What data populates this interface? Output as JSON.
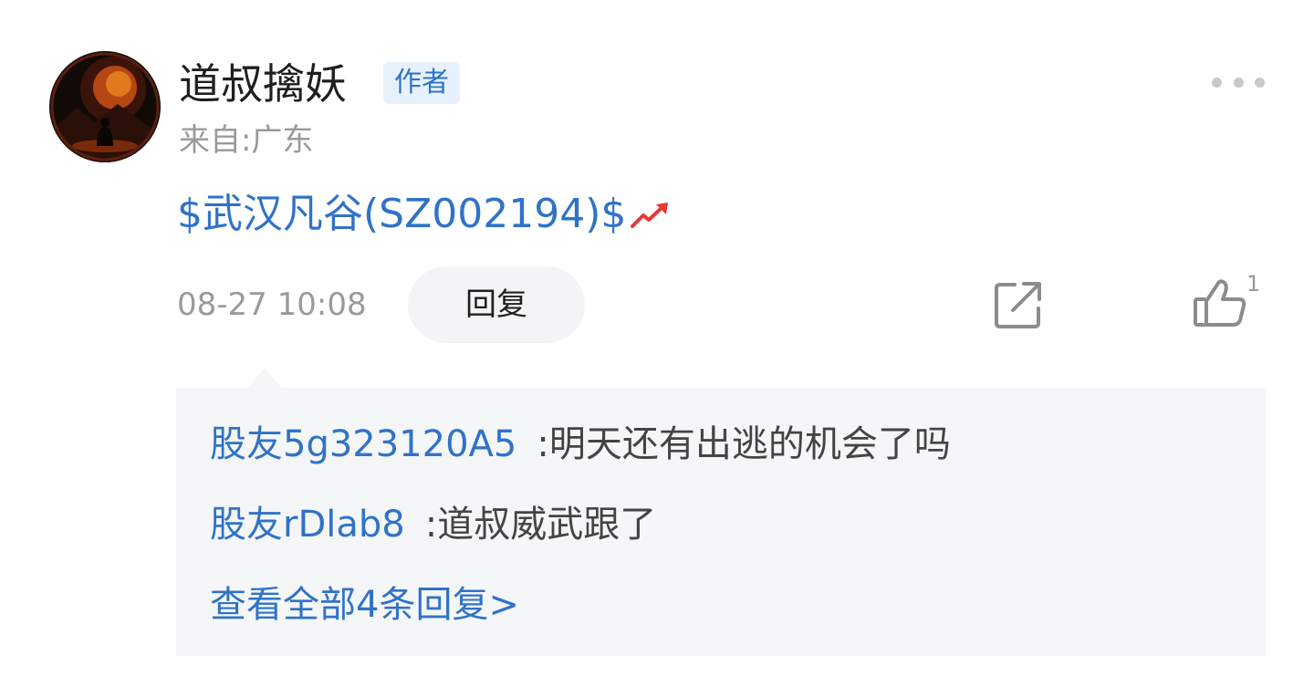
{
  "post": {
    "username": "道叔擒妖",
    "badge": "作者",
    "location": "来自:广东",
    "stock_text": "$武汉凡谷(SZ002194)$",
    "timestamp": "08-27 10:08",
    "reply_label": "回复",
    "like_count": "1"
  },
  "thread": {
    "replies": [
      {
        "user": "股友5g323120A5",
        "separator": ":",
        "text": "明天还有出逃的机会了吗"
      },
      {
        "user": "股友rDlab8",
        "separator": ":",
        "text": "道叔威武跟了"
      }
    ],
    "view_all": "查看全部4条回复>"
  },
  "icons": {
    "more": "more-dots-icon",
    "trend": "trend-up-icon",
    "share": "share-icon",
    "like": "thumbs-up-icon"
  },
  "colors": {
    "link_blue": "#2f73c7",
    "badge_bg": "#e7f1fb",
    "muted_gray": "#9a9a9a",
    "thread_bg": "#f5f6f8",
    "trend_red": "#e53935"
  }
}
